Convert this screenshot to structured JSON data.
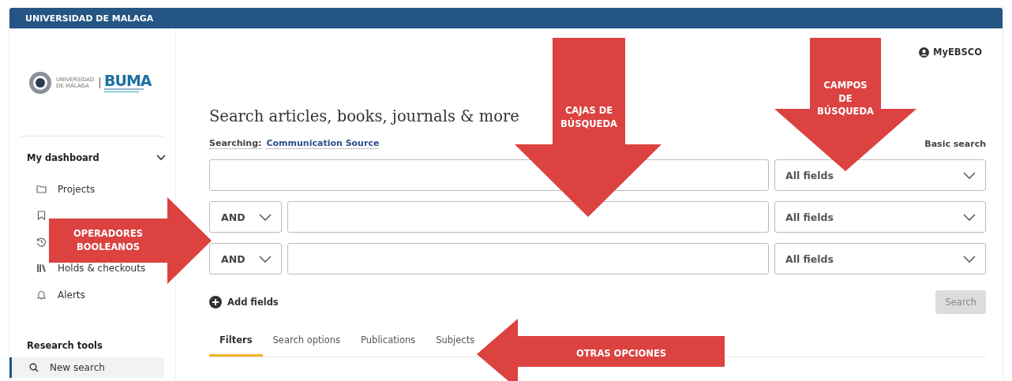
{
  "header_bar": {
    "title": "UNIVERSIDAD DE MALAGA"
  },
  "logo": {
    "university": "UNIVERSIDAD DE MÁLAGA",
    "library": "BUMA"
  },
  "sidebar": {
    "dashboard": {
      "title": "My dashboard",
      "expanded": true
    },
    "items": [
      {
        "kind": "folder",
        "label": "Projects"
      },
      {
        "kind": "bookmark"
      },
      {
        "kind": "history"
      },
      {
        "kind": "books",
        "label": "Holds & checkouts"
      },
      {
        "kind": "bell",
        "label": "Alerts"
      }
    ],
    "research_tools": {
      "title": "Research tools",
      "items": [
        {
          "kind": "search",
          "label": "New search",
          "selected": true
        }
      ]
    }
  },
  "main": {
    "account": "MyEBSCO",
    "heading": "Search articles, books, journals & more",
    "searching_label": "Searching:",
    "database": "Communication Source",
    "basic_search": "Basic search",
    "rows": [
      {
        "field": "All fields"
      },
      {
        "operator": "AND",
        "field": "All fields"
      },
      {
        "operator": "AND",
        "field": "All fields"
      }
    ],
    "add_fields": "Add fields",
    "search_button": {
      "label": "Search",
      "disabled": true
    },
    "tabs": [
      {
        "label": "Filters",
        "selected": true
      },
      {
        "label": "Search options",
        "selected": false
      },
      {
        "label": "Publications",
        "selected": false
      },
      {
        "label": "Subjects",
        "selected": false
      }
    ]
  },
  "annotations": [
    {
      "kind": "down",
      "lines": [
        "CAJAS  DE",
        "BÚSQUEDA"
      ]
    },
    {
      "kind": "down-small",
      "lines": [
        "CAMPOS",
        "DE",
        "BÚSQUEDA"
      ]
    },
    {
      "kind": "right",
      "lines": [
        "OPERADORES",
        "BOOLEANOS"
      ]
    },
    {
      "kind": "left",
      "lines": [
        "OTRAS OPCIONES"
      ]
    }
  ]
}
